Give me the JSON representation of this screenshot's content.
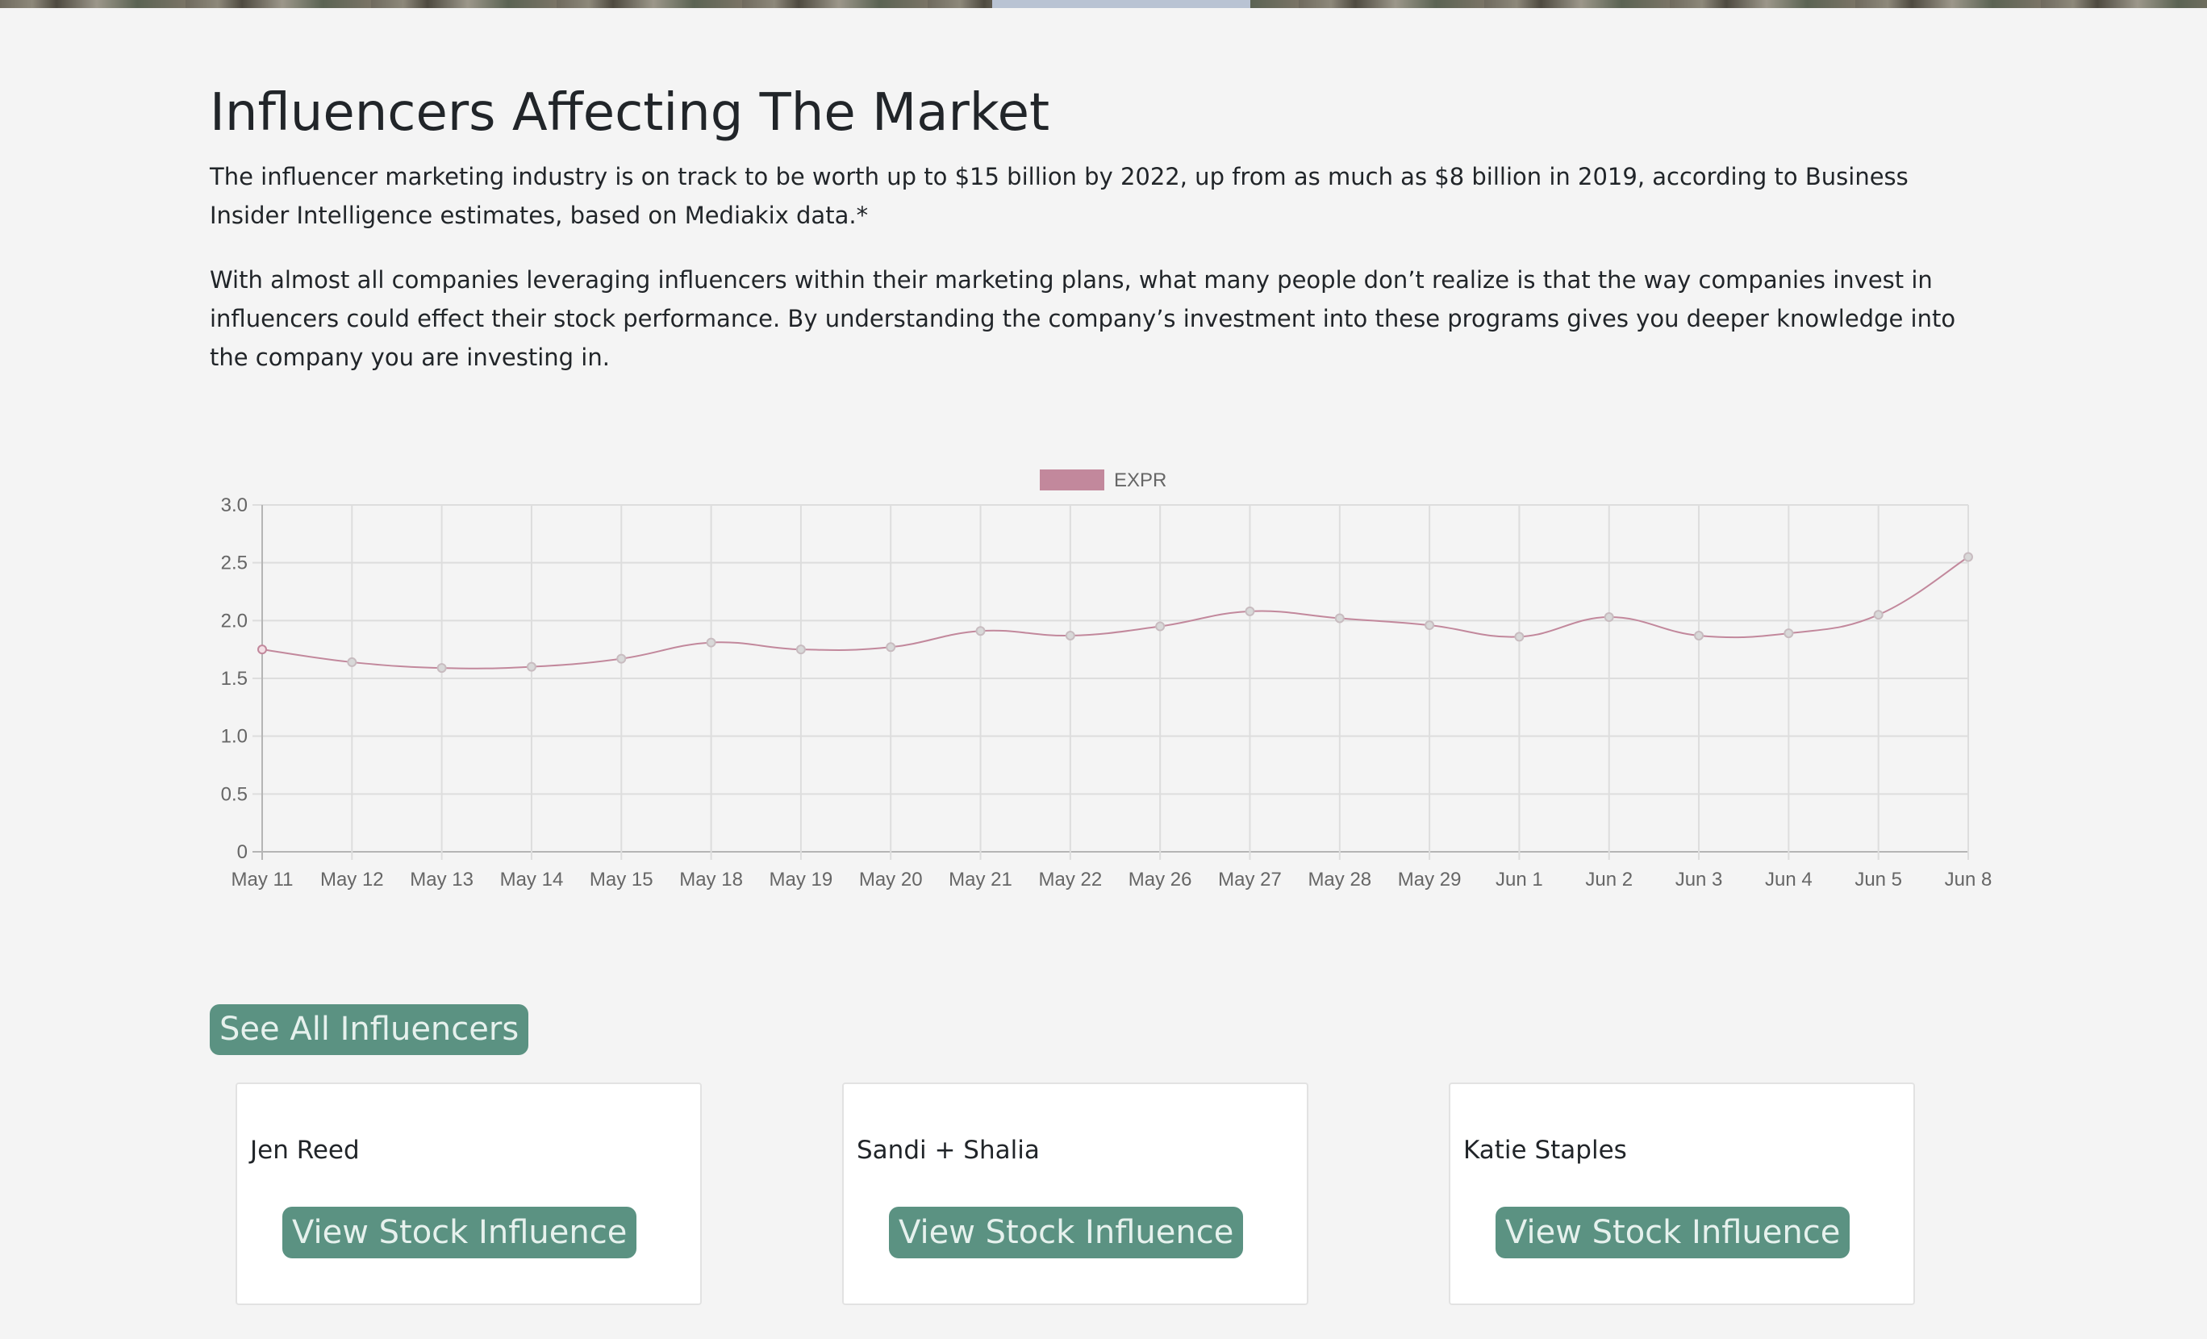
{
  "section": {
    "title": "Influencers Affecting The Market",
    "paragraph_1": "The influencer marketing industry is on track to be worth up to $15 billion by 2022, up from as much as $8 billion in 2019, according to Business Insider Intelligence estimates, based on Mediakix data.*",
    "paragraph_2": "With almost all companies leveraging influencers within their marketing plans, what many people don’t realize is that the way companies invest in influencers could effect their stock performance. By understanding the company’s investment into these programs gives you deeper knowledge into the company you are investing in."
  },
  "chart_data": {
    "type": "line",
    "categories": [
      "May 11",
      "May 12",
      "May 13",
      "May 14",
      "May 15",
      "May 18",
      "May 19",
      "May 20",
      "May 21",
      "May 22",
      "May 26",
      "May 27",
      "May 28",
      "May 29",
      "Jun 1",
      "Jun 2",
      "Jun 3",
      "Jun 4",
      "Jun 5",
      "Jun 8"
    ],
    "series": [
      {
        "name": "EXPR",
        "values": [
          1.75,
          1.64,
          1.59,
          1.6,
          1.67,
          1.81,
          1.75,
          1.77,
          1.91,
          1.87,
          1.95,
          2.08,
          2.02,
          1.96,
          1.86,
          2.03,
          1.87,
          1.89,
          2.05,
          2.55
        ],
        "color": "#c2889c"
      }
    ],
    "ylim": [
      0,
      3.0
    ],
    "yticks": [
      "0",
      "0.5",
      "1.0",
      "1.5",
      "2.0",
      "2.5",
      "3.0"
    ],
    "grid": true,
    "legend": "top-center"
  },
  "see_all_button": "See All Influencers",
  "cards": [
    {
      "name": "Jen Reed",
      "button": "View Stock Influence"
    },
    {
      "name": "Sandi + Shalia",
      "button": "View Stock Influence"
    },
    {
      "name": "Katie Staples",
      "button": "View Stock Influence"
    }
  ],
  "colors": {
    "background": "#f4f4f4",
    "button": "#5b9282",
    "button_text": "#e6f1ed",
    "series": "#c2889c"
  }
}
